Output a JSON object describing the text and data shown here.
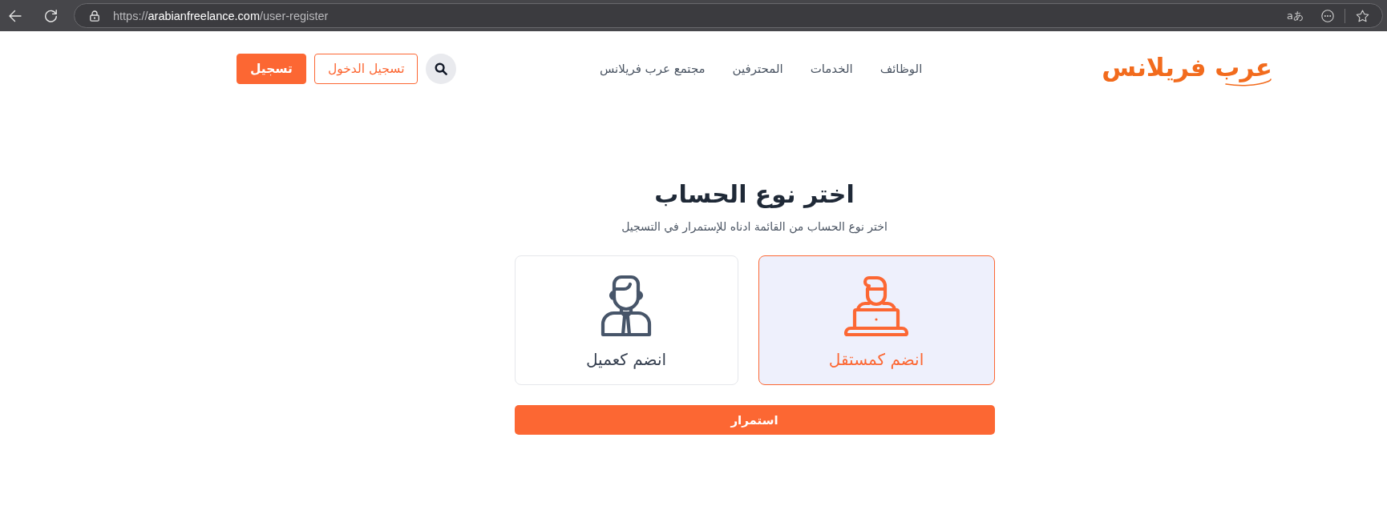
{
  "browser": {
    "url": {
      "scheme": "https://",
      "domain": "arabianfreelance.com",
      "path": "/user-register"
    },
    "translate_label": "aあ"
  },
  "header": {
    "logo": "عرب فريلانس",
    "nav": [
      "الوظائف",
      "الخدمات",
      "المحترفين",
      "مجتمع عرب فريلانس"
    ],
    "actions": [
      {
        "kind": "outline",
        "label": "تسجيل الدخول"
      },
      {
        "kind": "filled",
        "label": "تسجيل"
      }
    ]
  },
  "main": {
    "title": "اختر نوع الحساب",
    "subtitle": "اختر نوع الحساب من القائمة ادناه للإستمرار في التسجيل",
    "account_types": [
      {
        "kind": "freelancer",
        "label": "انضم كمستقل",
        "selected": true
      },
      {
        "kind": "client",
        "label": "انضم كعميل",
        "selected": false
      }
    ],
    "continue_button": "استمرار"
  }
}
